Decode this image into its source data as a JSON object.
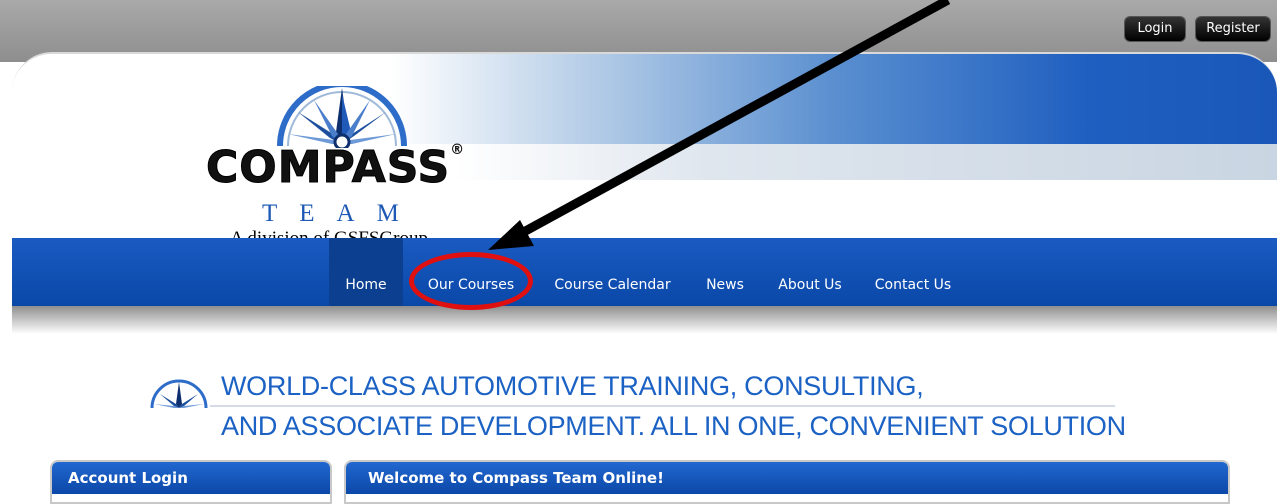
{
  "topbar": {
    "login_label": "Login",
    "register_label": "Register"
  },
  "logo": {
    "wordmark": "COMPASS",
    "registered": "®",
    "team": "TEAM",
    "division": "A division of GSFSGroup"
  },
  "nav": {
    "items": [
      "Home",
      "Our Courses",
      "Course Calendar",
      "News",
      "About Us",
      "Contact Us"
    ],
    "active": "Home"
  },
  "heading": {
    "line1": "WORLD-CLASS AUTOMOTIVE TRAINING, CONSULTING,",
    "line2": "AND ASSOCIATE DEVELOPMENT. ALL IN ONE, CONVENIENT SOLUTION"
  },
  "panels": {
    "account_title": "Account Login",
    "welcome_title": "Welcome to Compass Team Online!"
  },
  "colors": {
    "brand_blue": "#1a57b8",
    "annotation_red": "#e01010",
    "heading_blue": "#1b62c4"
  }
}
